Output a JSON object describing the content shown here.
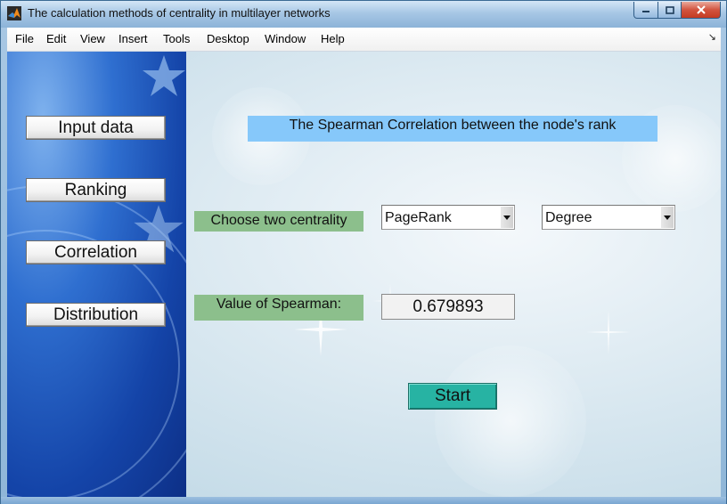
{
  "window": {
    "title": "The calculation methods of centrality in multilayer networks",
    "icons": {
      "app": "matlab-icon",
      "minimize": "minimize-icon",
      "maximize": "maximize-icon",
      "close": "close-icon"
    }
  },
  "menubar": {
    "items": [
      "File",
      "Edit",
      "View",
      "Insert",
      "Tools",
      "Desktop",
      "Window",
      "Help"
    ],
    "dock_icon": "dock-arrow-icon"
  },
  "sidebar": {
    "buttons": [
      "Input data",
      "Ranking",
      "Correlation",
      "Distribution"
    ]
  },
  "main": {
    "heading": "The Spearman Correlation between the node's rank",
    "choose_label": "Choose two centrality methods:",
    "select1": {
      "value": "PageRank"
    },
    "select2": {
      "value": "Degree"
    },
    "value_label": "Value of Spearman:",
    "spearman_value": "0.679893",
    "start_label": "Start"
  },
  "colors": {
    "heading_bg": "#86c8fa",
    "label_bg": "#8cbf8c",
    "start_bg": "#27b3a3",
    "sidebar_bg": "#1444a8"
  }
}
